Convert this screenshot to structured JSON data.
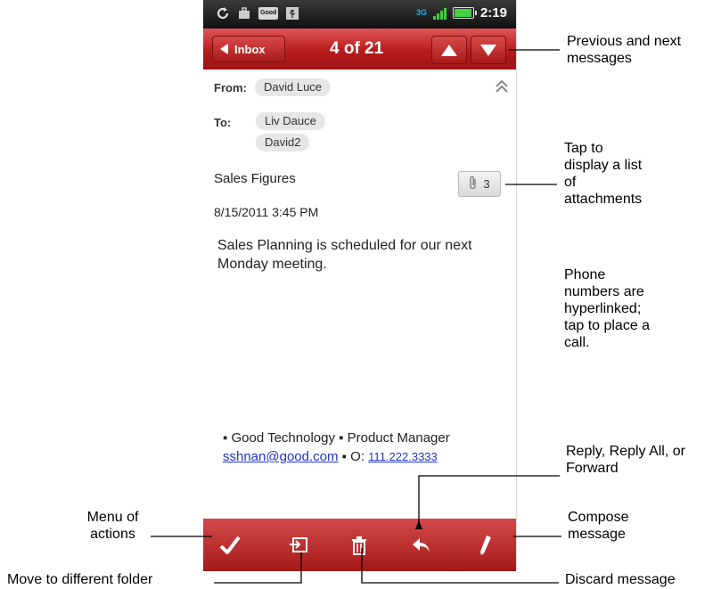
{
  "status_bar": {
    "left_icons": [
      "sync-icon",
      "briefcase-icon",
      "good-app-icon",
      "usb-icon"
    ],
    "good_label": "Good",
    "network_label": "3G",
    "time": "2:19"
  },
  "nav": {
    "back_label": "Inbox",
    "counter": "4 of 21",
    "prev_icon": "arrow-up-icon",
    "next_icon": "arrow-down-icon"
  },
  "header": {
    "from_label": "From:",
    "from": "David Luce",
    "to_label": "To:",
    "to": [
      "Liv Dauce",
      "David2"
    ],
    "collapse_icon": "double-chevron-up-icon"
  },
  "message": {
    "subject": "Sales Figures",
    "attachment_count": "3",
    "date": "8/15/2011 3:45 PM",
    "body": "Sales Planning is scheduled for our next Monday meeting.",
    "signature": {
      "company": "Good Technology",
      "title": "Product Manager",
      "email": "sshnan@good.com",
      "phone_prefix": "O:",
      "phone": "111.222.3333"
    }
  },
  "toolbar": {
    "items": [
      "menu-check-icon",
      "move-folder-icon",
      "trash-icon",
      "reply-icon",
      "compose-pencil-icon"
    ]
  },
  "annotations": {
    "prev_next": "Previous and next messages",
    "attachments": "Tap to display a list of attachments",
    "phone_links": "Phone numbers are hyperlinked; tap to place a call.",
    "reply": "Reply, Reply All, or Forward",
    "compose": "Compose message",
    "menu": "Menu of actions",
    "move": "Move to different folder",
    "discard": "Discard message"
  },
  "colors": {
    "accent_red": "#b71b1b",
    "link_blue": "#2233cc",
    "status_bar": "#111111"
  }
}
